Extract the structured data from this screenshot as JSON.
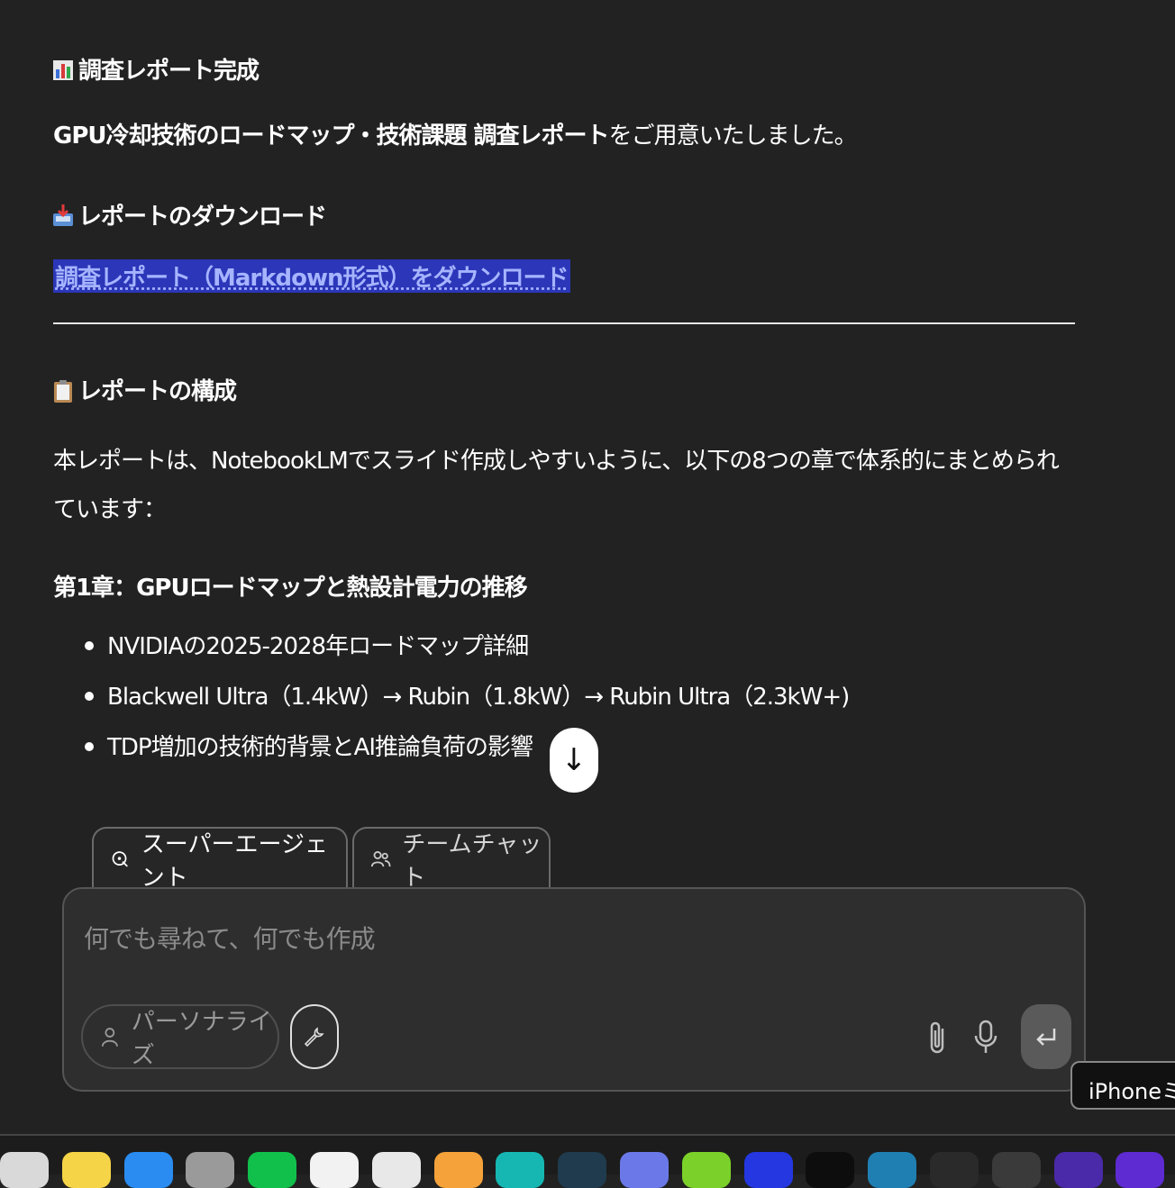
{
  "report": {
    "heading": "調査レポート完成",
    "intro_bold": "GPU冷却技術のロードマップ・技術課題 調査レポート",
    "intro_rest": "をご用意いたしました。",
    "download_heading": "レポートのダウンロード",
    "download_link": "調査レポート（Markdown形式）をダウンロード",
    "structure_heading": "レポートの構成",
    "structure_text": "本レポートは、NotebookLMでスライド作成しやすいように、以下の8つの章で体系的にまとめられています：",
    "chapter1_heading": "第1章：GPUロードマップと熱設計電力の推移",
    "chapter1_items": [
      "NVIDIAの2025-2028年ロードマップ詳細",
      "Blackwell Ultra（1.4kW）→ Rubin（1.8kW）→ Rubin Ultra（2.3kW+)",
      "TDP増加の技術的背景とAI推論負荷の影響"
    ]
  },
  "scroll_button": {
    "glyph": "↓",
    "icon": "arrow-down-icon"
  },
  "tabs": [
    {
      "label": "スーパーエージェント",
      "icon": "agent-icon",
      "active": true
    },
    {
      "label": "チームチャット",
      "icon": "people-icon",
      "active": false
    }
  ],
  "composer": {
    "placeholder": "何でも尋ねて、何でも作成",
    "personalize_label": "パーソナライズ",
    "personalize_icon": "person-icon",
    "tool_icon": "wrench-icon",
    "attach_icon": "paperclip-icon",
    "mic_icon": "microphone-icon",
    "send_icon": "enter-icon"
  },
  "tooltip": {
    "text": "iPhoneミラ"
  },
  "colors": {
    "background": "#222222",
    "link_bg": "#2b36b8",
    "link_text": "#a6b4ff",
    "composer_bg": "#2e2e2e"
  },
  "dock": {
    "icons": [
      {
        "name": "finder-icon",
        "color": "#d9d9d9"
      },
      {
        "name": "notes-icon",
        "color": "#f5d547"
      },
      {
        "name": "xcode-icon",
        "color": "#2a8cf0"
      },
      {
        "name": "settings-icon",
        "color": "#9a9a9a"
      },
      {
        "name": "line-icon",
        "color": "#11c04b"
      },
      {
        "name": "chatgpt-icon",
        "color": "#f2f2f2"
      },
      {
        "name": "calendar-icon",
        "color": "#e8e8e8"
      },
      {
        "name": "pages-icon",
        "color": "#f5a23a"
      },
      {
        "name": "app-teal-icon",
        "color": "#16b7b2"
      },
      {
        "name": "perplexity-icon",
        "color": "#1f3b4d"
      },
      {
        "name": "discord-icon",
        "color": "#6b79e8"
      },
      {
        "name": "app-green-icon",
        "color": "#7bd12a"
      },
      {
        "name": "app-blue-icon",
        "color": "#2437e0"
      },
      {
        "name": "app-dark-icon",
        "color": "#0d0d0d"
      },
      {
        "name": "app-globe-icon",
        "color": "#1f7fb3"
      },
      {
        "name": "app-white-icon",
        "color": "#2a2a2a"
      },
      {
        "name": "app-tour-icon",
        "color": "#3a3a3a"
      },
      {
        "name": "app-purple-icon",
        "color": "#4a2aa8"
      },
      {
        "name": "app-gradient-icon",
        "color": "#5d2bd1"
      },
      {
        "name": "app-last-icon",
        "color": "#c9c9c9"
      }
    ]
  }
}
